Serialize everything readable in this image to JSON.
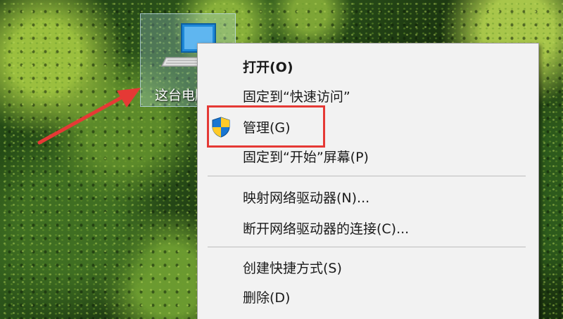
{
  "desktop": {
    "icon_label": "这台电脑",
    "icon_name": "this-pc-icon"
  },
  "annotation": {
    "arrow_color": "#e53935",
    "highlight_color": "#e53935"
  },
  "context_menu": {
    "items": [
      {
        "label": "打开(O)"
      },
      {
        "label": "固定到“快速访问”"
      },
      {
        "label": "管理(G)",
        "icon": "uac-shield-icon"
      },
      {
        "label": "固定到“开始”屏幕(P)"
      },
      {
        "label": "映射网络驱动器(N)..."
      },
      {
        "label": "断开网络驱动器的连接(C)..."
      },
      {
        "label": "创建快捷方式(S)"
      },
      {
        "label": "删除(D)"
      }
    ]
  }
}
